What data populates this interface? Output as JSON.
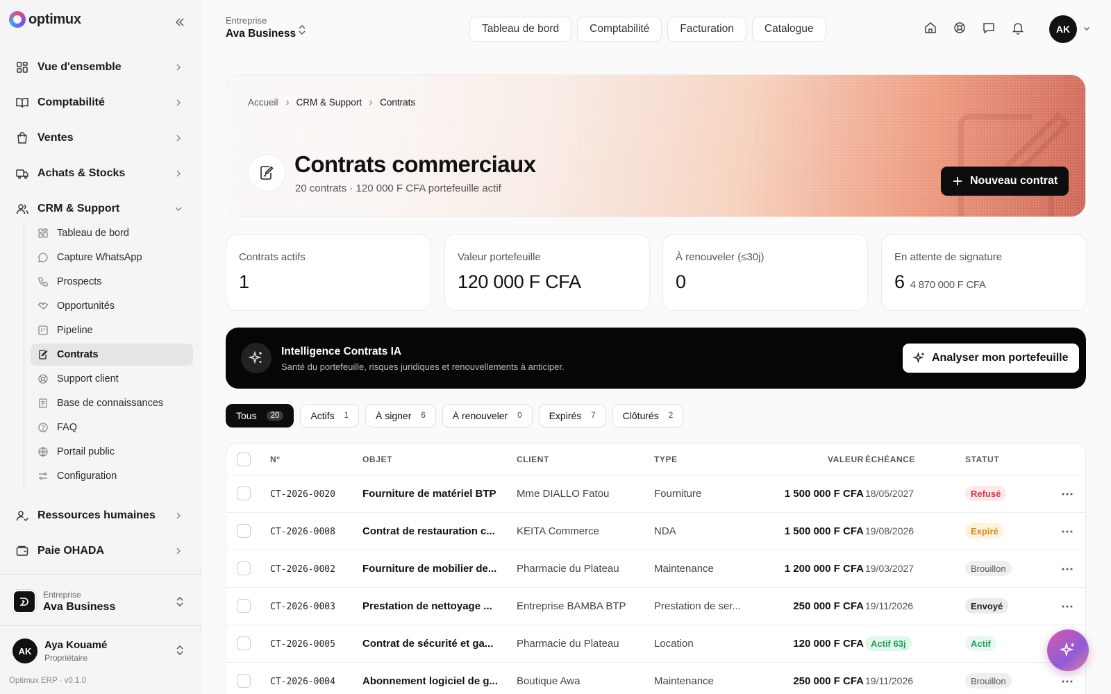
{
  "brand": {
    "name": "optimux"
  },
  "sidebar": {
    "main_items": [
      {
        "label": "Vue d'ensemble"
      },
      {
        "label": "Comptabilité"
      },
      {
        "label": "Ventes"
      },
      {
        "label": "Achats & Stocks"
      },
      {
        "label": "CRM & Support"
      }
    ],
    "crm_items": [
      {
        "label": "Tableau de bord"
      },
      {
        "label": "Capture WhatsApp"
      },
      {
        "label": "Prospects"
      },
      {
        "label": "Opportunités"
      },
      {
        "label": "Pipeline"
      },
      {
        "label": "Contrats"
      },
      {
        "label": "Support client"
      },
      {
        "label": "Base de connaissances"
      },
      {
        "label": "FAQ"
      },
      {
        "label": "Portail public"
      },
      {
        "label": "Configuration"
      }
    ],
    "bottom_items": [
      {
        "label": "Ressources humaines"
      },
      {
        "label": "Paie OHADA"
      }
    ],
    "company": {
      "caption": "Entreprise",
      "name": "Ava Business"
    },
    "user": {
      "initials": "AK",
      "name": "Aya Kouamé",
      "role": "Propriétaire"
    },
    "version": "Optimux ERP · v0.1.0"
  },
  "topbar": {
    "company_caption": "Entreprise",
    "company_name": "Ava Business",
    "tabs": [
      {
        "label": "Tableau de bord"
      },
      {
        "label": "Comptabilité"
      },
      {
        "label": "Facturation"
      },
      {
        "label": "Catalogue"
      }
    ],
    "icons": [
      "home-icon",
      "help-icon",
      "message-icon",
      "bell-icon"
    ],
    "avatar_initials": "AK"
  },
  "hero": {
    "breadcrumb": [
      "Accueil",
      "CRM & Support",
      "Contrats"
    ],
    "title": "Contrats commerciaux",
    "subtitle": "20 contrats · 120 000 F CFA portefeuille actif",
    "new_button": "Nouveau contrat"
  },
  "kpis": [
    {
      "label": "Contrats actifs",
      "value": "1",
      "extra": ""
    },
    {
      "label": "Valeur portefeuille",
      "value": "120 000 F CFA",
      "extra": ""
    },
    {
      "label": "À renouveler (≤30j)",
      "value": "0",
      "extra": ""
    },
    {
      "label": "En attente de signature",
      "value": "6",
      "extra": "4 870 000 F CFA"
    }
  ],
  "ai_banner": {
    "title": "Intelligence Contrats IA",
    "subtitle": "Santé du portefeuille, risques juridiques et renouvellements à anticiper.",
    "button": "Analyser mon portefeuille"
  },
  "filters": [
    {
      "label": "Tous",
      "count": "20",
      "active": true
    },
    {
      "label": "Actifs",
      "count": "1"
    },
    {
      "label": "À signer",
      "count": "6"
    },
    {
      "label": "À renouveler",
      "count": "0"
    },
    {
      "label": "Expirés",
      "count": "7"
    },
    {
      "label": "Clôturés",
      "count": "2"
    }
  ],
  "table": {
    "columns": {
      "num": "N°",
      "objet": "OBJET",
      "client": "CLIENT",
      "type": "TYPE",
      "valeur": "VALEUR",
      "echeance": "ÉCHÉANCE",
      "statut": "STATUT"
    },
    "rows": [
      {
        "num": "CT-2026-0020",
        "objet": "Fourniture de matériel BTP",
        "client": "Mme DIALLO Fatou",
        "type": "Fourniture",
        "valeur": "1 500 000 F CFA",
        "echeance": "18/05/2027",
        "echeance_badge": "",
        "statut": "Refusé"
      },
      {
        "num": "CT-2026-0008",
        "objet": "Contrat de restauration c...",
        "client": "KEITA Commerce",
        "type": "NDA",
        "valeur": "1 500 000 F CFA",
        "echeance": "19/08/2026",
        "echeance_badge": "",
        "statut": "Expiré"
      },
      {
        "num": "CT-2026-0002",
        "objet": "Fourniture de mobilier de...",
        "client": "Pharmacie du Plateau",
        "type": "Maintenance",
        "valeur": "1 200 000 F CFA",
        "echeance": "19/03/2027",
        "echeance_badge": "",
        "statut": "Brouillon"
      },
      {
        "num": "CT-2026-0003",
        "objet": "Prestation de nettoyage ...",
        "client": "Entreprise BAMBA BTP",
        "type": "Prestation de ser...",
        "valeur": "250 000 F CFA",
        "echeance": "19/11/2026",
        "echeance_badge": "",
        "statut": "Envoyé"
      },
      {
        "num": "CT-2026-0005",
        "objet": "Contrat de sécurité et ga...",
        "client": "Pharmacie du Plateau",
        "type": "Location",
        "valeur": "120 000 F CFA",
        "echeance": "",
        "echeance_badge": "Actif 63j",
        "statut": "Actif"
      },
      {
        "num": "CT-2026-0004",
        "objet": "Abonnement logiciel de g...",
        "client": "Boutique Awa",
        "type": "Maintenance",
        "valeur": "250 000 F CFA",
        "echeance": "19/11/2026",
        "echeance_badge": "",
        "statut": "Brouillon"
      }
    ]
  },
  "colors": {
    "accent": "#0d0d0d",
    "refused": "#d23a4a",
    "expired": "#d88d1a",
    "active": "#1e9d5f"
  }
}
